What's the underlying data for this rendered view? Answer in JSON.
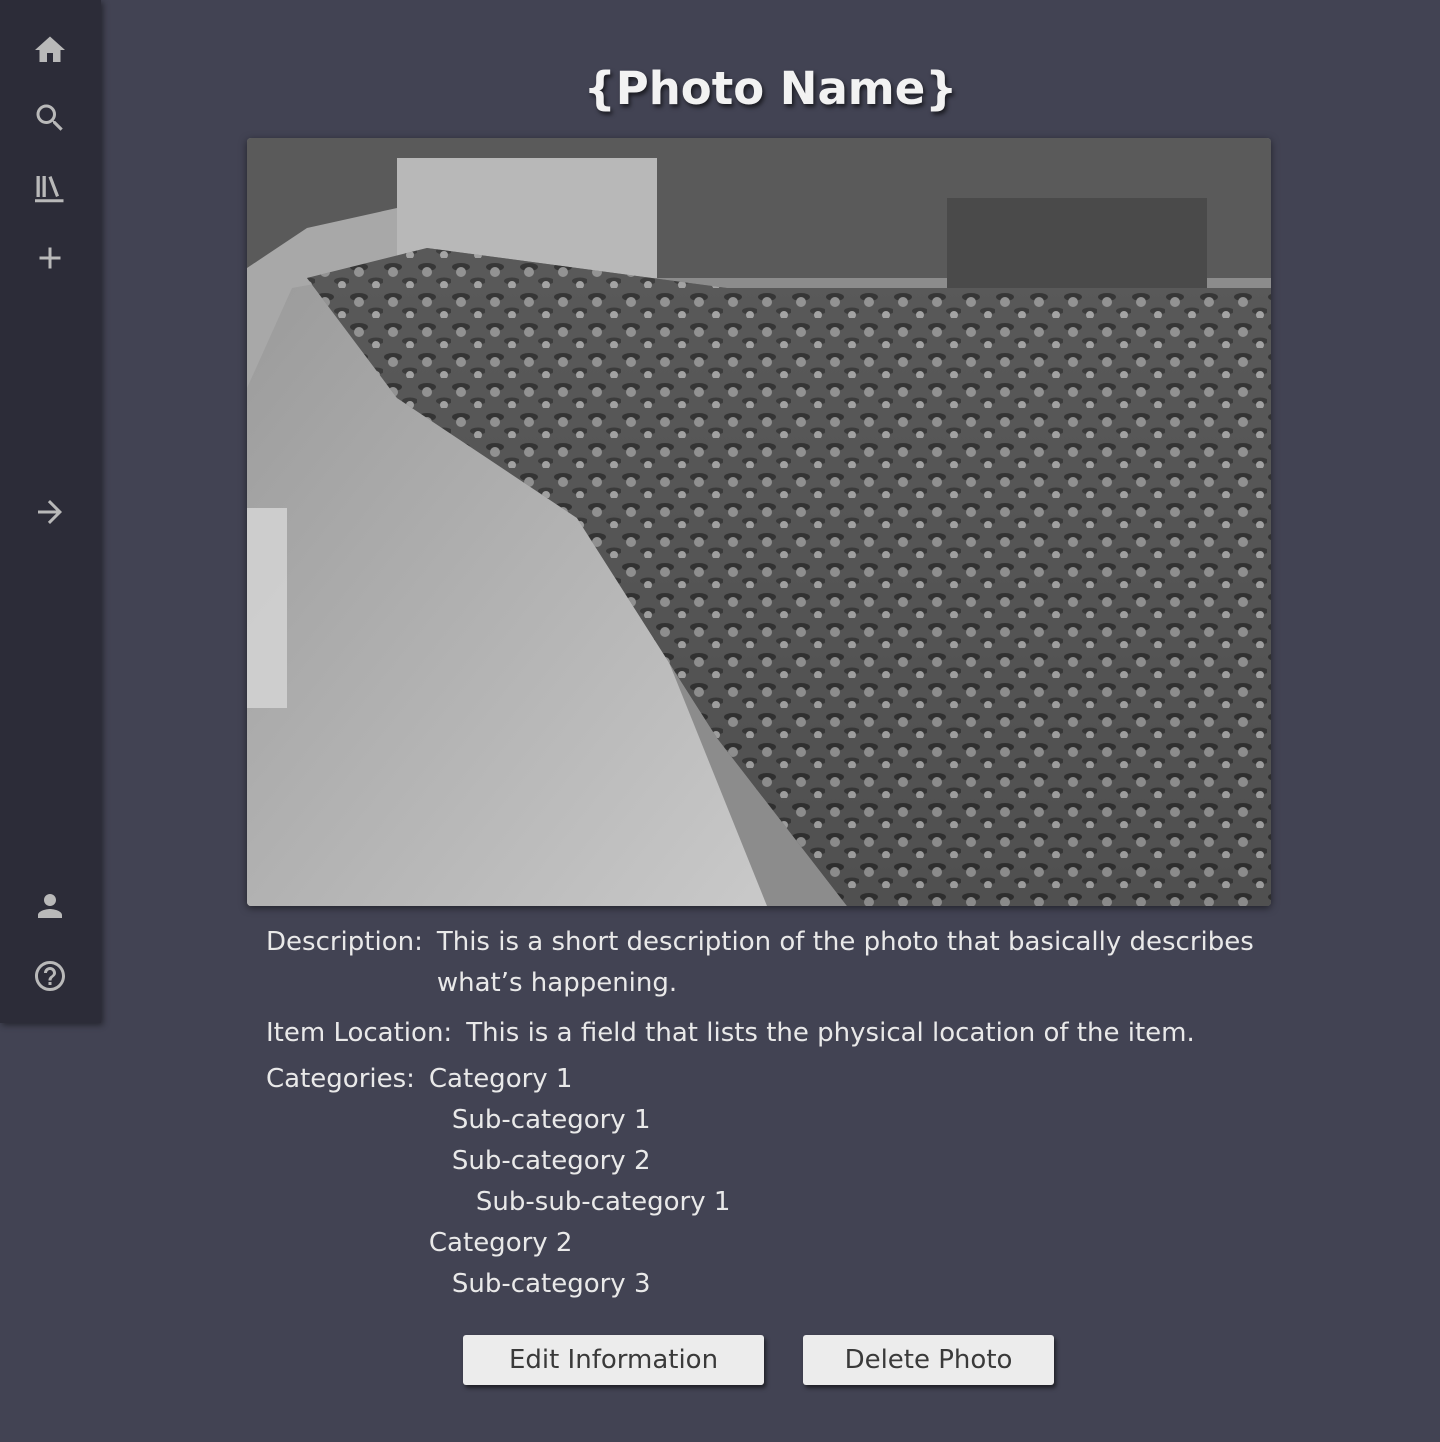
{
  "sidebar": {
    "items": [
      {
        "icon": "home-icon"
      },
      {
        "icon": "search-icon"
      },
      {
        "icon": "library-icon"
      },
      {
        "icon": "plus-icon"
      },
      {
        "icon": "arrow-right-icon"
      },
      {
        "icon": "person-icon"
      },
      {
        "icon": "help-icon"
      }
    ]
  },
  "page": {
    "title": "{Photo Name}"
  },
  "details": {
    "description_label": "Description:",
    "description": "This is a short description of the photo that basically describes what’s happening.",
    "location_label": "Item Location:",
    "location": "This is a field that lists the physical location of the item.",
    "categories_label": "Categories:",
    "categories": [
      {
        "name": "Category 1",
        "level": 0
      },
      {
        "name": "Sub-category 1",
        "level": 1
      },
      {
        "name": "Sub-category 2",
        "level": 1
      },
      {
        "name": "Sub-sub-category 1",
        "level": 2
      },
      {
        "name": "Category 2",
        "level": 0
      },
      {
        "name": "Sub-category 3",
        "level": 1
      }
    ]
  },
  "actions": {
    "edit_label": "Edit Information",
    "delete_label": "Delete Photo"
  },
  "colors": {
    "background": "#424353",
    "sidebar": "#2c2c38",
    "icon": "#b9b9b9",
    "button": "#ececec"
  }
}
